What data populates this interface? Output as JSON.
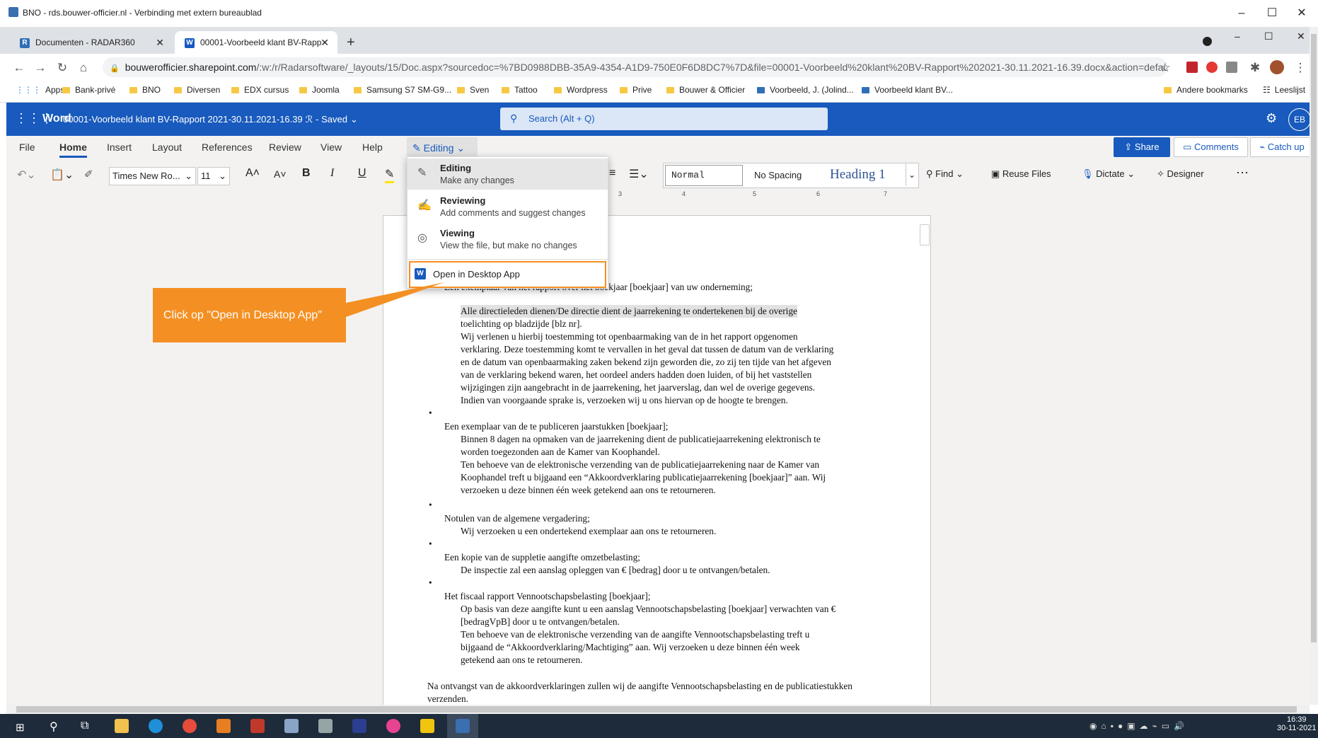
{
  "window": {
    "title": "BNO - rds.bouwer-officier.nl - Verbinding met extern bureaublad",
    "controls": [
      "–",
      "☐",
      "✕"
    ]
  },
  "browser": {
    "tabs": [
      {
        "label": "Documenten - RADAR360",
        "fav": "R",
        "active": false
      },
      {
        "label": "00001-Voorbeeld klant BV-Rapp",
        "fav": "W",
        "active": true
      }
    ],
    "new_tab": "+",
    "url_host": "bouwerofficier.sharepoint.com",
    "url_path": "/:w:/r/Radarsoftware/_layouts/15/Doc.aspx?sourcedoc=%7BD0988DBB-35A9-4354-A1D9-750E0F6D8DC7%7D&file=00001-Voorbeeld%20klant%20BV-Rapport%202021-30.11.2021-16.39.docx&action=default&...",
    "bookmarks": [
      "Apps",
      "Bank-privé",
      "BNO",
      "Diversen",
      "EDX cursus",
      "Joomla",
      "Samsung S7 SM-G9...",
      "Sven",
      "Tattoo",
      "Wordpress",
      "Prive",
      "Bouwer & Officier",
      "Voorbeeld, J. (Jolind...",
      "Voorbeeld klant BV..."
    ],
    "other_bookmarks": "Andere bookmarks",
    "reading_list": "Leeslijst"
  },
  "word": {
    "app_name": "Word",
    "doc_title": "00001-Voorbeeld klant BV-Rapport 2021-30.11.2021-16.39",
    "saved": "- Saved",
    "search_placeholder": "Search (Alt + Q)",
    "user_initials": "EB",
    "ribbon_tabs": [
      "File",
      "Home",
      "Insert",
      "Layout",
      "References",
      "Review",
      "View",
      "Help"
    ],
    "mode_button": "Editing",
    "share": "Share",
    "comments": "Comments",
    "catch_up": "Catch up",
    "font_name": "Times New Ro...",
    "font_size": "11",
    "styles": [
      "Normal",
      "No Spacing",
      "Heading 1"
    ],
    "find": "Find",
    "reuse_files": "Reuse Files",
    "dictate": "Dictate",
    "designer": "Designer",
    "ruler_numbers": [
      "3",
      "4",
      "5",
      "6",
      "7"
    ]
  },
  "mode_menu": {
    "items": [
      {
        "title": "Editing",
        "subtitle": "Make any changes",
        "icon": "pencil-icon"
      },
      {
        "title": "Reviewing",
        "subtitle": "Add comments and suggest changes",
        "icon": "review-icon"
      },
      {
        "title": "Viewing",
        "subtitle": "View the file, but make no changes",
        "icon": "eye-icon"
      }
    ],
    "open_desktop": "Open in Desktop App"
  },
  "callout": {
    "text": "Click op \"Open in Desktop App\""
  },
  "document": {
    "lines": [
      {
        "text": "Een exemplaar van het rapport over het boekjaar [boekjaar] van uw onderneming;"
      },
      {
        "text": "Alle directieleden dienen/De directie dient de jaarrekening te ondertekenen bij de overige"
      },
      {
        "text": "toelichting op bladzijde [blz nr]."
      },
      {
        "text": "Wij verlenen u hierbij toestemming tot openbaarmaking van de in het rapport opgenomen"
      },
      {
        "text": "verklaring. Deze toestemming komt te vervallen in het geval dat tussen de datum van de verklaring"
      },
      {
        "text": "en de datum van openbaarmaking zaken bekend zijn geworden die, zo zij ten tijde van het afgeven"
      },
      {
        "text": "van de verklaring bekend waren, het oordeel anders hadden doen luiden, of bij het vaststellen"
      },
      {
        "text": "wijzigingen zijn aangebracht in de jaarrekening, het jaarverslag, dan wel de overige gegevens."
      },
      {
        "text": "Indien van voorgaande sprake is, verzoeken wij u ons hiervan op de hoogte te brengen."
      },
      {
        "text": "Een exemplaar van de te publiceren jaarstukken [boekjaar];"
      },
      {
        "text": "Binnen 8 dagen na opmaken van de jaarrekening dient de publicatiejaarrekening elektronisch te"
      },
      {
        "text": "worden toegezonden aan de Kamer van Koophandel."
      },
      {
        "text": "Ten behoeve van de elektronische verzending van de publicatiejaarrekening naar de Kamer van"
      },
      {
        "text": "Koophandel treft u bijgaand een “Akkoordverklaring publicatiejaarrekening [boekjaar]” aan. Wij"
      },
      {
        "text": "verzoeken u deze binnen één week getekend aan ons te retourneren."
      },
      {
        "text": "Notulen van de algemene vergadering;"
      },
      {
        "text": "Wij verzoeken u een ondertekend exemplaar aan ons te retourneren."
      },
      {
        "text": "Een kopie van de suppletie aangifte omzetbelasting;"
      },
      {
        "text": "De inspectie zal een aanslag opleggen van € [bedrag] door u te ontvangen/betalen."
      },
      {
        "text": "Het fiscaal rapport Vennootschapsbelasting [boekjaar];"
      },
      {
        "text": "Op basis van deze aangifte kunt u een aanslag Vennootschapsbelasting [boekjaar] verwachten van €"
      },
      {
        "text": "[bedragVpB] door u te ontvangen/betalen."
      },
      {
        "text": "Ten behoeve van de elektronische verzending van de aangifte Vennootschapsbelasting treft u"
      },
      {
        "text": "bijgaand de “Akkoordverklaring/Machtiging” aan. Wij verzoeken u deze binnen één week"
      },
      {
        "text": "getekend aan ons te retourneren."
      },
      {
        "text": "Na ontvangst van de akkoordverklaringen zullen wij de aangifte Vennootschapsbelasting en de publicatiestukken"
      },
      {
        "text": "verzenden."
      }
    ]
  },
  "taskbar": {
    "time": "16:39",
    "date": "30-11-2021"
  }
}
